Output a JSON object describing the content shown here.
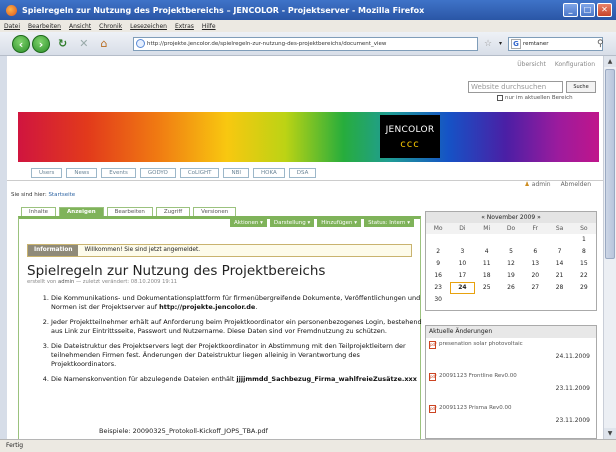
{
  "window": {
    "title": "Spielregeln zur Nutzung des Projektbereichs – JENCOLOR - Projektserver - Mozilla Firefox"
  },
  "menu": [
    "Datei",
    "Bearbeiten",
    "Ansicht",
    "Chronik",
    "Lesezeichen",
    "Extras",
    "Hilfe"
  ],
  "browser": {
    "url": "http://projekte.jencolor.de/spielregeln-zur-nutzung-des-projektbereichs/document_view",
    "search_value": "remtaner",
    "status": "Fertig"
  },
  "site": {
    "top_links": [
      "Übersicht",
      "Konfiguration"
    ],
    "search_placeholder": "Website durchsuchen",
    "search_button": "Suche",
    "search_option": "nur im aktuellen Bereich",
    "logo_text": "JENCOLOR",
    "logo_mark": "ccc",
    "nav": [
      "Users",
      "News",
      "Events",
      "GODYO",
      "CoLIGHT",
      "NBI",
      "HOKA",
      "DSA"
    ],
    "user": "admin",
    "logout": "Abmelden",
    "breadcrumb_label": "Sie sind hier:",
    "breadcrumb_link": "Startseite"
  },
  "edit_tabs": [
    "Inhalte",
    "Anzeigen",
    "Bearbeiten",
    "Zugriff",
    "Versionen"
  ],
  "action_menu": [
    "Aktionen ▾",
    "Darstellung ▾",
    "Hinzufügen ▾",
    "Status: Intern ▾"
  ],
  "message": {
    "label": "Information",
    "text": "Willkommen! Sie sind jetzt angemeldet."
  },
  "document": {
    "title": "Spielregeln zur Nutzung des Projektbereichs",
    "byline_prefix": "erstellt von",
    "author": "admin",
    "byline_suffix": "— zuletzt verändert: 08.10.2009 19:11",
    "items": [
      {
        "text": "Die Kommunikations- und Dokumentationsplattform für firmenübergreifende Dokumente, Veröffentlichungen und Normen ist der Projektserver auf ",
        "bold": "http://projekte.jencolor.de",
        "tail": "."
      },
      {
        "text": "Jeder Projektteilnehmer erhält auf Anforderung beim Projektkoordinator ein personenbezogenes Login, bestehend aus Link zur Eintrittsseite, Passwort und Nutzername. Diese Daten sind vor Fremdnutzung zu schützen.",
        "bold": "",
        "tail": ""
      },
      {
        "text": "Die Dateistruktur des Projektservers legt der Projektkoordinator in Abstimmung mit den Teilprojektleitern der teilnehmenden Firmen fest. Änderungen der Dateistruktur liegen alleinig in Verantwortung des Projektkoordinators.",
        "bold": "",
        "tail": ""
      },
      {
        "text": "Die Namenskonvention für abzulegende Dateien enthält ",
        "bold": "jjjjmmdd_Sachbezug_Firma_wahlfreieZusätze.xxx",
        "tail": ""
      }
    ],
    "example": "Beispiele: 20090325_Protokoll-Kickoff_JOPS_TBA.pdf"
  },
  "calendar": {
    "title": "« November 2009 »",
    "days": [
      "Mo",
      "Di",
      "Mi",
      "Do",
      "Fr",
      "Sa",
      "So"
    ],
    "weeks": [
      [
        "",
        "",
        "",
        "",
        "",
        "",
        "1"
      ],
      [
        "2",
        "3",
        "4",
        "5",
        "6",
        "7",
        "8"
      ],
      [
        "9",
        "10",
        "11",
        "12",
        "13",
        "14",
        "15"
      ],
      [
        "16",
        "17",
        "18",
        "19",
        "20",
        "21",
        "22"
      ],
      [
        "23",
        "24",
        "25",
        "26",
        "27",
        "28",
        "29"
      ],
      [
        "30",
        "",
        "",
        "",
        "",
        "",
        ""
      ]
    ],
    "today": "24"
  },
  "recent": {
    "title": "Aktuelle Änderungen",
    "items": [
      {
        "name": "presenation solar photovoltaic",
        "date": "24.11.2009"
      },
      {
        "name": "20091123 Frontline Rev0.00",
        "date": "23.11.2009"
      },
      {
        "name": "20091123 Prisma Rev0.00",
        "date": "23.11.2009"
      }
    ]
  }
}
